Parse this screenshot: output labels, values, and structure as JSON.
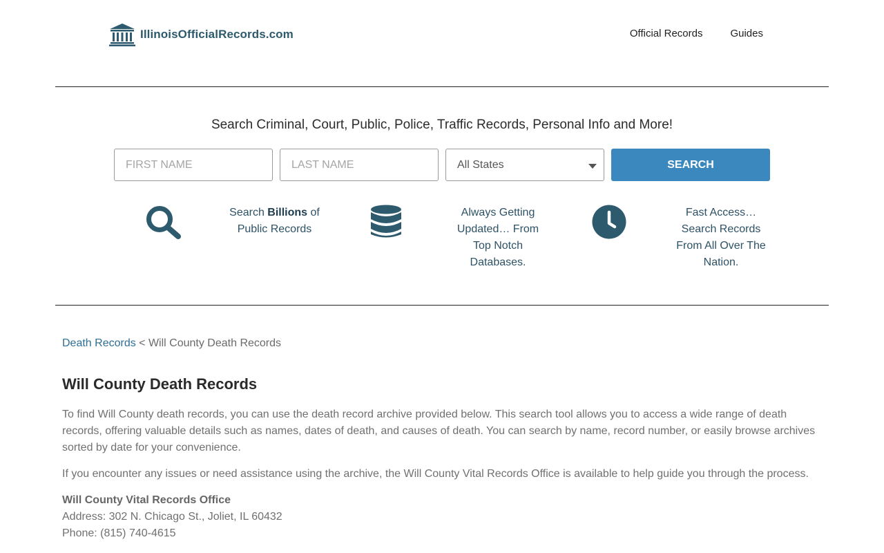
{
  "site": {
    "logo_text": "IllinoisOfficialRecords.com"
  },
  "nav": {
    "items": [
      "Official Records",
      "Guides"
    ]
  },
  "search": {
    "title": "Search Criminal, Court, Public, Police, Traffic Records, Personal Info and More!",
    "first_name_placeholder": "FIRST NAME",
    "last_name_placeholder": "LAST NAME",
    "state_selected": "All States",
    "button_label": "SEARCH"
  },
  "features": [
    {
      "icon": "search-icon",
      "pre": "Search ",
      "bold": "Billions",
      "post": " of",
      "line2": "Public Records"
    },
    {
      "icon": "database-icon",
      "lines": [
        "Always Getting",
        "Updated… From",
        "Top Notch",
        "Databases."
      ]
    },
    {
      "icon": "clock-icon",
      "lines": [
        "Fast Access…",
        "Search Records",
        "From All Over The",
        "Nation."
      ]
    }
  ],
  "breadcrumb": {
    "link": "Death Records",
    "separator": " < ",
    "current": "Will County Death Records"
  },
  "content": {
    "title": "Will County Death Records",
    "paragraph1": "To find Will County death records, you can use the death record archive provided below. This search tool allows you to access a wide range of death records, offering valuable details such as names, dates of death, and causes of death. You can search by name, record number, or easily browse archives sorted by date for your convenience.",
    "paragraph2": "If you encounter any issues or need assistance using the archive, the Will County Vital Records Office is available to help guide you through the process.",
    "office_name": "Will County Vital Records Office",
    "office_address": "Address: 302 N. Chicago St., Joliet, IL 60432",
    "office_phone": "Phone: (815) 740-4615"
  },
  "colors": {
    "accent": "#3a88bd",
    "icon": "#2e5a6e",
    "link": "#2e6f96"
  }
}
